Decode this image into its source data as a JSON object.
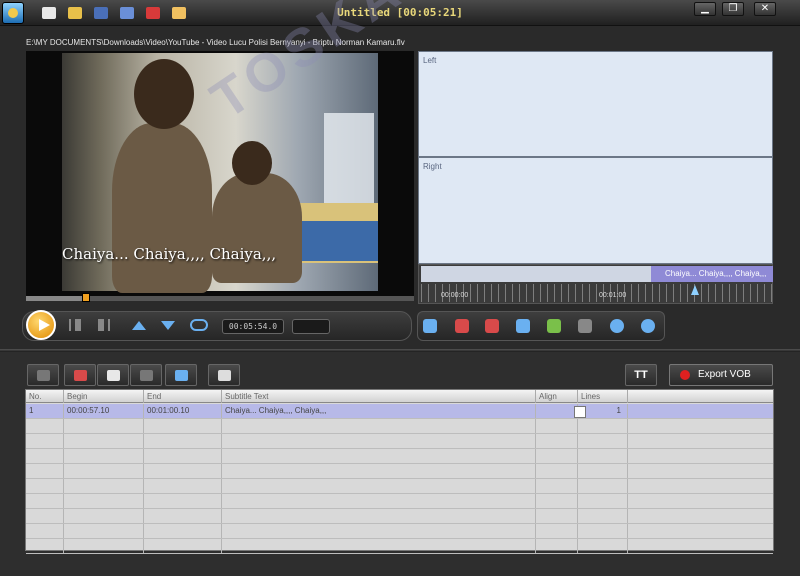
{
  "window": {
    "title": "Untitled [00:05:21]",
    "min": "▁",
    "restore": "❐",
    "close": "✕"
  },
  "toolbar": {
    "icons": [
      "new-document-icon",
      "open-folder-icon",
      "save-icon",
      "save-as-icon",
      "help-icon",
      "settings-wrench-icon"
    ]
  },
  "video": {
    "path": "E:\\MY DOCUMENTS\\Downloads\\Video\\YouTube - Video Lucu Polisi Bernyanyi - Briptu Norman Kamaru.flv",
    "subtitle": "Chaiya... Chaiya,,,, Chaiya,,,"
  },
  "panels": {
    "left_label": "Left",
    "right_label": "Right"
  },
  "timeline": {
    "segment_text": "Chaiya... Chaiya,,,, Chaiya,,,",
    "ticks": [
      "00:00:00",
      "00:01:00"
    ],
    "playhead": 0.15
  },
  "player": {
    "time": "00:05:54.0",
    "total": "00:05:21"
  },
  "subs": {
    "export_label": "Export VOB",
    "tt_label": "TT",
    "columns": [
      "No.",
      "Begin",
      "End",
      "Subtitle Text",
      "Align",
      "Lines"
    ],
    "rows": [
      {
        "no": "1",
        "begin": "00:00:57.10",
        "end": "00:01:00.10",
        "text": "Chaiya... Chaiya,,,, Chaiya,,,",
        "lines": "1"
      }
    ]
  },
  "colors": {
    "accent": "#f0a020",
    "selection": "#b7b9e8",
    "panel": "#dfe8f4",
    "timeline_segment": "#8f8ad6"
  }
}
